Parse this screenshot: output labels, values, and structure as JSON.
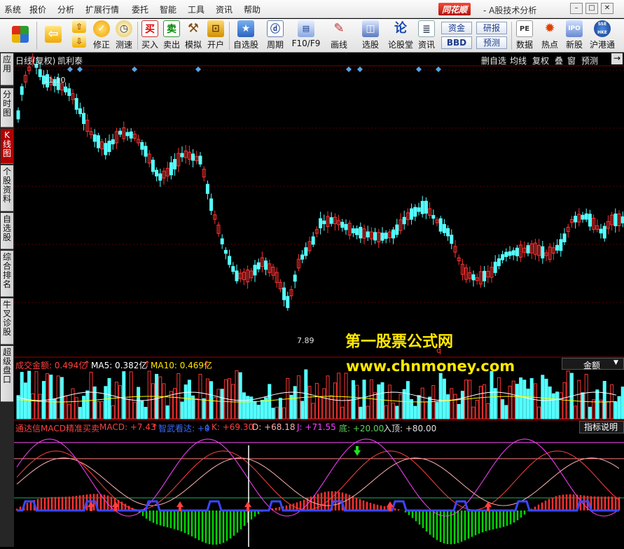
{
  "menu": [
    "系统",
    "报价",
    "分析",
    "扩展行情",
    "委托",
    "智能",
    "工具",
    "资讯",
    "帮助"
  ],
  "brand": "同花顺",
  "app_subtitle": "- A股技术分析",
  "window_buttons": [
    "–",
    "□",
    "✕"
  ],
  "toolbar": {
    "items": [
      {
        "label": "",
        "icon": "windows-logo-icon"
      },
      {
        "label": "",
        "icon": "back-arrow-icon"
      },
      {
        "label": "",
        "icon": "up-down-icon"
      },
      {
        "label": "修正",
        "icon": "fix-icon"
      },
      {
        "label": "测速",
        "icon": "clock-icon"
      },
      {
        "label": "买入",
        "icon": "buy-icon"
      },
      {
        "label": "卖出",
        "icon": "sell-icon"
      },
      {
        "label": "模拟",
        "icon": "hammer-icon"
      },
      {
        "label": "开户",
        "icon": "lock-icon"
      },
      {
        "label": "自选股",
        "icon": "star-icon"
      },
      {
        "label": "周期",
        "icon": "cycle-icon"
      },
      {
        "label": "F10/F9",
        "icon": "f10-icon"
      },
      {
        "label": "画线",
        "icon": "pencil-icon"
      },
      {
        "label": "选股",
        "icon": "screen-icon"
      },
      {
        "label": "论股堂",
        "icon": "forum-icon"
      },
      {
        "label": "资讯",
        "icon": "news-icon"
      },
      {
        "label": "数据",
        "icon": "pe-icon"
      },
      {
        "label": "热点",
        "icon": "hot-icon"
      },
      {
        "label": "新股",
        "icon": "ipo-icon"
      },
      {
        "label": "沪港通",
        "icon": "sse-hkex-icon"
      }
    ],
    "box_buttons": [
      "资金",
      "研报",
      "BBD",
      "预测"
    ],
    "icon_texts": {
      "buy": "买",
      "sell": "卖",
      "forum": "论",
      "pe": "PE",
      "ipo": "IPO",
      "sse": "SSE HKE",
      "cycle": "ⓓ"
    }
  },
  "sidebar": [
    {
      "label": "应用",
      "active": false
    },
    {
      "label": "分时图",
      "active": false
    },
    {
      "label": "K线图",
      "active": true
    },
    {
      "label": "个股资料",
      "active": false
    },
    {
      "label": "自选股",
      "active": false
    },
    {
      "label": "综合排名",
      "active": false
    },
    {
      "label": "牛叉诊股",
      "active": false
    },
    {
      "label": "超级盘口",
      "active": false
    }
  ],
  "chart_header": {
    "title": "日线(复权)",
    "stock_name": "凯利泰",
    "right_buttons": [
      "删自选",
      "均线",
      "复权",
      "叠",
      "窗",
      "预测"
    ],
    "arrow_button": "→"
  },
  "kline": {
    "high_label": "11.10",
    "low_label": "7.89",
    "marker_q": "q",
    "watermark_title": "第一股票公式网",
    "watermark_url": "www.chnmoney.com"
  },
  "volume_panel": {
    "label_main": "成交金额: 0.494亿",
    "label_ma5": "MA5: 0.382亿",
    "label_ma10": "MA10: 0.469亿",
    "arrow": "↑",
    "dropdown": "金额"
  },
  "indicator_panel": {
    "name": "通达信MACD精准买卖",
    "macd": "MACD: +7.43",
    "macd_arrow": "↑",
    "form": "智武看达: +0",
    "form_arrow": "↓",
    "k": "K: +69.30",
    "d": "D: +68.18",
    "j": "J: +71.55",
    "bottom": "底: +20.00",
    "top": "入顶: +80.00",
    "explain_button": "指标说明"
  },
  "colors": {
    "up": "#ff3232",
    "down": "#54ffff",
    "ma5": "#ffffff",
    "ma10": "#ffff00",
    "k": "#ff4040",
    "d": "#ffb0b0",
    "j": "#ff40ff",
    "macd_pos": "#ff3030",
    "macd_neg": "#00d800",
    "signal": "#3a46ff",
    "bg": "#000000"
  }
}
